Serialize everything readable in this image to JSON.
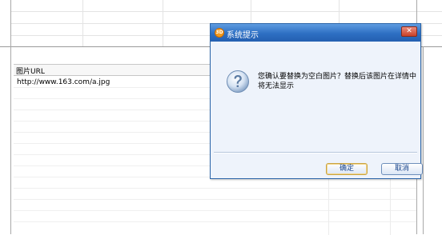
{
  "table": {
    "header": "图片URL",
    "rows": [
      "http://www.163.com/a.jpg"
    ]
  },
  "dialog": {
    "title": "系统提示",
    "app_icon_text": "3D",
    "close_glyph": "✕",
    "message": "您确认要替换为空白图片？替换后该图片在详情中将无法显示",
    "ok_label": "确定",
    "cancel_label": "取消"
  },
  "icons": {
    "dialog_icon": "question-icon",
    "close": "close-icon"
  },
  "colors": {
    "titlebar": "#2d6fc3",
    "dialog_bg": "#eef3fb",
    "ok_border": "#c9a442"
  }
}
